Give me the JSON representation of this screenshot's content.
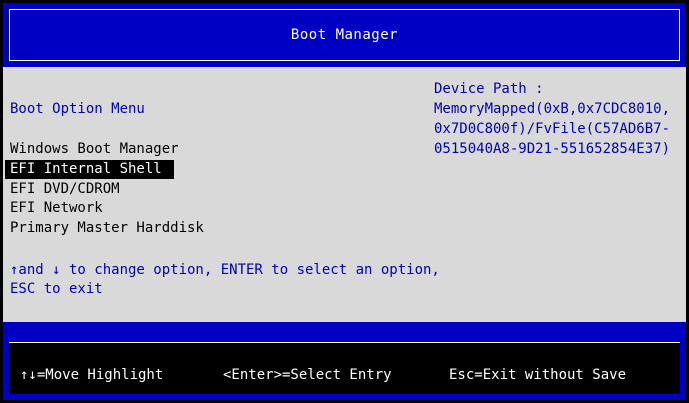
{
  "header": {
    "title": "Boot Manager"
  },
  "menu": {
    "title": "Boot Option Menu",
    "options": [
      {
        "label": "Windows Boot Manager",
        "selected": false
      },
      {
        "label": "EFI Internal Shell",
        "selected": true
      },
      {
        "label": "EFI DVD/CDROM",
        "selected": false
      },
      {
        "label": "EFI Network",
        "selected": false
      },
      {
        "label": "Primary Master Harddisk",
        "selected": false
      }
    ],
    "help_line1": "↑and ↓ to change option, ENTER to select an option,",
    "help_line2": "ESC to exit"
  },
  "device_path": {
    "label": "Device Path :",
    "value": "MemoryMapped(0xB,0x7CDC8010,0x7D0C800f)/FvFile(C57AD6B7-0515040A8-9D21-551652854E37)"
  },
  "footer": {
    "move_hint": "↑↓=Move Highlight",
    "enter_hint": "<Enter>=Select Entry",
    "esc_hint": "Esc=Exit without Save"
  },
  "colors": {
    "band_blue": "#0000c4",
    "text_blue": "#0000b8",
    "panel_gray": "#d9d9d9",
    "highlight_bg": "#000000"
  }
}
